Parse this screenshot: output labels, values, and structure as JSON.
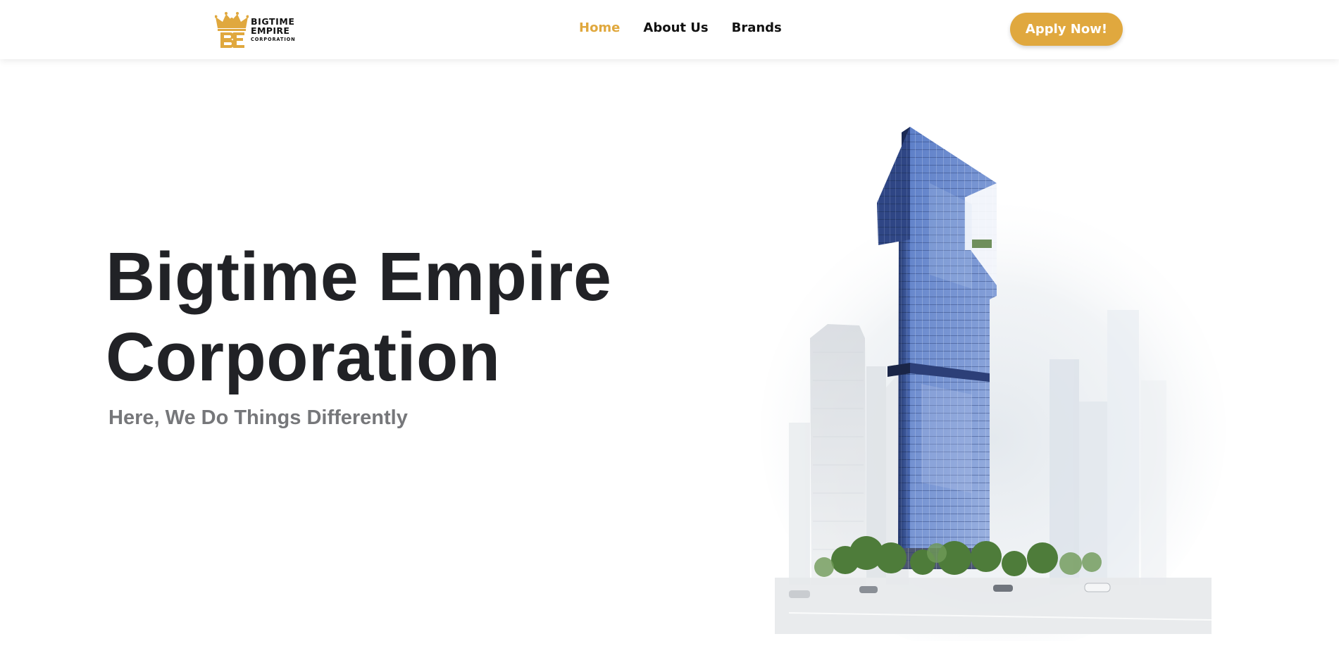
{
  "header": {
    "logo": {
      "line1": "BIGTIME",
      "line2": "EMPIRE",
      "line3": "CORPORATION",
      "icon": "crown-be-monogram-icon",
      "color": "#e0a83e"
    },
    "nav": [
      {
        "label": "Home",
        "active": true
      },
      {
        "label": "About Us",
        "active": false
      },
      {
        "label": "Brands",
        "active": false
      }
    ],
    "cta_label": "Apply Now!"
  },
  "hero": {
    "title_line1": "Bigtime Empire",
    "title_line2": "Corporation",
    "subtitle": "Here, We Do Things Differently",
    "illustration": "glass-skyscraper-illustration"
  },
  "colors": {
    "accent": "#e0a83e",
    "title": "#212226",
    "subtitle": "#76777a",
    "nav_text": "#111111"
  }
}
